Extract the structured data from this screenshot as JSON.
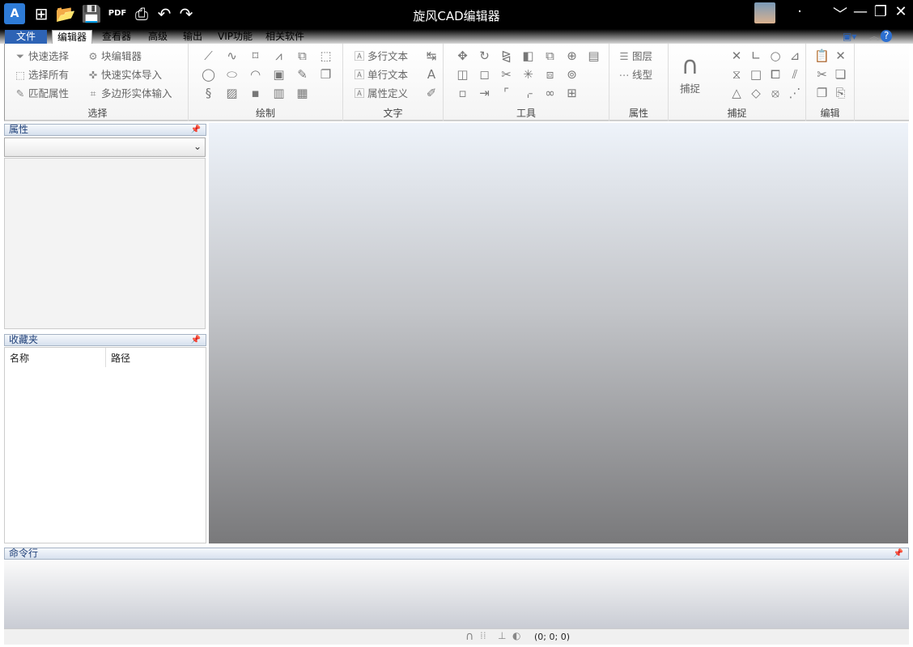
{
  "titlebar": {
    "title": "旋风CAD编辑器",
    "logo": "A"
  },
  "tabs": [
    "文件",
    "编辑器",
    "查看器",
    "高级",
    "输出",
    "VIP功能",
    "相关软件"
  ],
  "ribbon": {
    "select": {
      "label": "选择",
      "buttons": [
        "快速选择",
        "选择所有",
        "匹配属性",
        "块编辑器",
        "快速实体导入",
        "多边形实体输入"
      ]
    },
    "draw": {
      "label": "绘制",
      "icons": [
        [
          "line-icon",
          "⟋"
        ],
        [
          "freehand-icon",
          "∿"
        ],
        [
          "rectangle-icon",
          "⌑"
        ],
        [
          "polyline-icon",
          "⩘"
        ],
        [
          "insert-block-icon",
          "⧉"
        ],
        [
          "region-icon",
          "⬚"
        ],
        [
          "circle-icon",
          "◯"
        ],
        [
          "ellipse-icon",
          "⬭"
        ],
        [
          "arc-icon",
          "◠"
        ],
        [
          "image-icon",
          "▣"
        ],
        [
          "pen-icon",
          "✎"
        ],
        [
          "layers-icon",
          "❐"
        ],
        [
          "spline-icon",
          "§"
        ],
        [
          "hatch-icon",
          "▨"
        ],
        [
          "point-icon",
          "▪"
        ],
        [
          "picture-icon",
          "▥"
        ],
        [
          "table-icon",
          "▦"
        ],
        [
          "blank-icon",
          " "
        ]
      ]
    },
    "text": {
      "label": "文字",
      "buttons": [
        "多行文本",
        "单行文本",
        "属性定义"
      ],
      "icons": [
        [
          "text-scale-icon",
          "↹"
        ],
        [
          "text-style-icon",
          "A"
        ],
        [
          "edit-text-icon",
          "✐"
        ]
      ]
    },
    "tools": {
      "label": "工具",
      "icons": [
        [
          "move-icon",
          "✥"
        ],
        [
          "rotate-icon",
          "↻"
        ],
        [
          "mirror-icon",
          "⧎"
        ],
        [
          "fill-icon",
          "◧"
        ],
        [
          "copy-icon",
          "⧉"
        ],
        [
          "insert-icon",
          "⊕"
        ],
        [
          "align-icon",
          "▤"
        ],
        [
          "stretch-icon",
          "◫"
        ],
        [
          "scale-icon",
          "◻"
        ],
        [
          "trim-icon",
          "✂"
        ],
        [
          "explode-icon",
          "✳"
        ],
        [
          "group-icon",
          "⧈"
        ],
        [
          "ungroup-icon",
          "⊚"
        ],
        [
          "blank",
          ""
        ],
        [
          "array-icon",
          "▫"
        ],
        [
          "break-icon",
          "⇥"
        ],
        [
          "fillet-icon",
          "⌜"
        ],
        [
          "chamfer-icon",
          "⌌"
        ],
        [
          "join-icon",
          "∞"
        ],
        [
          "block-add-icon",
          "⊞"
        ],
        [
          "blank2",
          ""
        ]
      ]
    },
    "props": {
      "label": "属性",
      "buttons": [
        "图层",
        "线型"
      ]
    },
    "snap": {
      "label": "捕捉",
      "button": "捕捉",
      "icons": [
        [
          "snap-intersection-icon",
          "✕"
        ],
        [
          "snap-perpendicular-icon",
          "∟"
        ],
        [
          "snap-center-icon",
          "○"
        ],
        [
          "snap-angle-icon",
          "⊿"
        ],
        [
          "snap-midpoint-icon",
          "⧖"
        ],
        [
          "snap-quadrant-icon",
          "□"
        ],
        [
          "snap-insert-icon",
          "⧠"
        ],
        [
          "snap-parallel-icon",
          "⫽"
        ],
        [
          "snap-triangle-icon",
          "△"
        ],
        [
          "snap-node-icon",
          "◇"
        ],
        [
          "snap-tangent-icon",
          "⦻"
        ],
        [
          "snap-nearest-icon",
          "⋰"
        ]
      ]
    },
    "edit": {
      "label": "编辑",
      "icons": [
        [
          "paste-icon",
          "📋"
        ],
        [
          "delete-icon",
          "✕"
        ],
        [
          "cut-icon",
          "✂"
        ],
        [
          "paste-special-icon",
          "❏"
        ],
        [
          "copy-icon",
          "❐"
        ],
        [
          "copy-base-icon",
          "⎘"
        ]
      ]
    }
  },
  "panels": {
    "properties": "属性",
    "favorites": "收藏夹",
    "fav_cols": [
      "名称",
      "路径"
    ],
    "command": "命令行"
  },
  "status": {
    "coords": "(0; 0; 0)"
  }
}
